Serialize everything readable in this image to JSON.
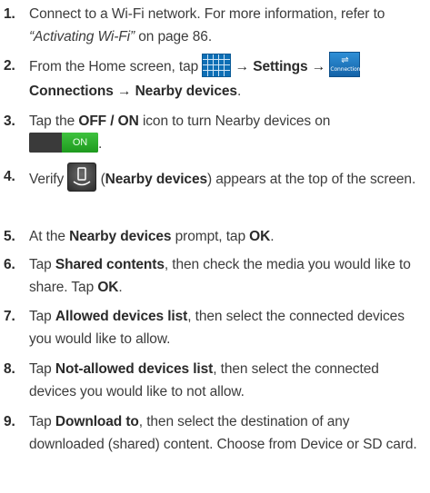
{
  "steps": [
    {
      "num": "1.",
      "p1": "Connect to a Wi-Fi network. For more information, refer to ",
      "ref": "“Activating Wi-Fi”",
      "p2": " on page 86."
    },
    {
      "num": "2.",
      "p1": "From the Home screen, tap ",
      "arrow1": " → ",
      "settings": "Settings",
      "arrow2": " → ",
      "connections": "Connections",
      "arrow3": " → ",
      "nearby": "Nearby devices",
      "end": ".",
      "conn_icon_label": "Connections"
    },
    {
      "num": "3.",
      "p1": "Tap the ",
      "bold": "OFF / ON",
      "p2": " icon to turn Nearby devices on",
      "toggle_label": "ON",
      "end": "."
    },
    {
      "num": "4.",
      "p1": "Verify ",
      "p2": " (",
      "bold": "Nearby devices",
      "p3": ") appears at the top of the screen."
    },
    {
      "num": "5.",
      "p1": "At the ",
      "bold1": "Nearby devices",
      "p2": " prompt, tap ",
      "bold2": "OK",
      "end": "."
    },
    {
      "num": "6.",
      "p1": "Tap ",
      "bold1": "Shared contents",
      "p2": ", then check the media you would like to share. Tap ",
      "bold2": "OK",
      "end": "."
    },
    {
      "num": "7.",
      "p1": "Tap ",
      "bold": "Allowed devices list",
      "p2": ", then select the connected devices you would like to allow."
    },
    {
      "num": "8.",
      "p1": "Tap ",
      "bold": "Not-allowed devices list",
      "p2": ", then select the connected devices you would like to not allow."
    },
    {
      "num": "9.",
      "p1": "Tap ",
      "bold": "Download to",
      "p2": ", then select the destination of any downloaded (shared) content. Choose from Device or SD card."
    }
  ],
  "icons": {
    "apps": "apps-grid-icon",
    "connections": "connections-tab-icon",
    "toggle": "on-off-toggle",
    "nearby": "nearby-devices-icon"
  }
}
